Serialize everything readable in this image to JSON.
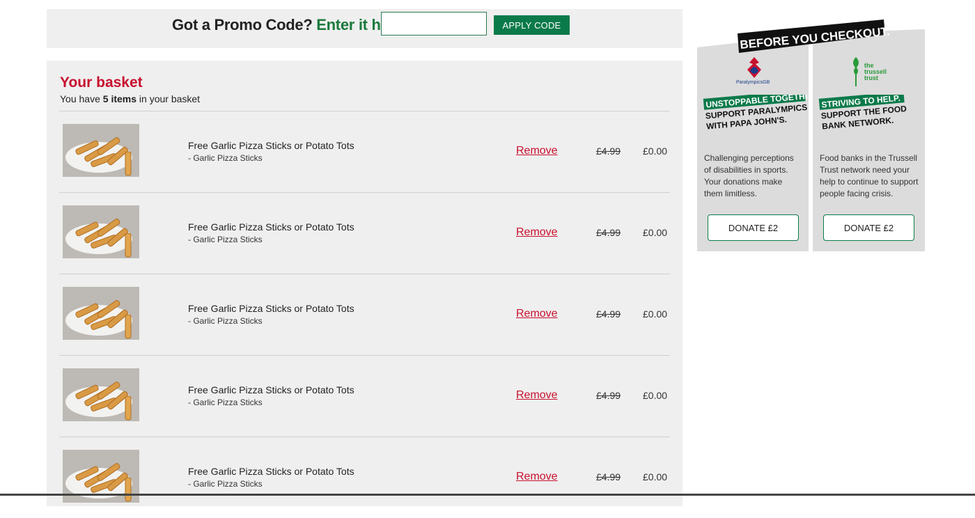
{
  "promo": {
    "question": "Got a Promo Code?",
    "link_text": "Enter it here",
    "input_value": "",
    "button_label": "APPLY CODE"
  },
  "basket": {
    "title": "Your basket",
    "subtitle_prefix": "You have",
    "count_text": "5 items",
    "subtitle_suffix": "in your basket",
    "items": [
      {
        "name": "Free Garlic Pizza Sticks or Potato Tots",
        "option": "- Garlic Pizza Sticks",
        "remove": "Remove",
        "old_price": "£4.99",
        "price": "£0.00"
      },
      {
        "name": "Free Garlic Pizza Sticks or Potato Tots",
        "option": "- Garlic Pizza Sticks",
        "remove": "Remove",
        "old_price": "£4.99",
        "price": "£0.00"
      },
      {
        "name": "Free Garlic Pizza Sticks or Potato Tots",
        "option": "- Garlic Pizza Sticks",
        "remove": "Remove",
        "old_price": "£4.99",
        "price": "£0.00"
      },
      {
        "name": "Free Garlic Pizza Sticks or Potato Tots",
        "option": "- Garlic Pizza Sticks",
        "remove": "Remove",
        "old_price": "£4.99",
        "price": "£0.00"
      },
      {
        "name": "Free Garlic Pizza Sticks or Potato Tots",
        "option": "- Garlic Pizza Sticks",
        "remove": "Remove",
        "old_price": "£4.99",
        "price": "£0.00"
      }
    ]
  },
  "checkout_promo": {
    "heading": "BEFORE YOU CHECKOUT.",
    "cards": [
      {
        "logo_text": "ParalympicsGB",
        "headline_1": "UNSTOPPABLE TOGETHER.",
        "headline_2": "SUPPORT PARALYMPICSGB",
        "headline_3": "WITH PAPA JOHN'S.",
        "body": "Challenging perceptions of disabilities in sports. Your donations make them limitless.",
        "button_label": "DONATE £2"
      },
      {
        "logo_text_1": "the",
        "logo_text_2": "trussell",
        "logo_text_3": "trust",
        "headline_1": "STRIVING TO HELP.",
        "headline_2": "SUPPORT THE FOOD",
        "headline_3": "BANK NETWORK.",
        "body": "Food banks in the Trussell Trust network need your help to continue to support people facing crisis.",
        "button_label": "DONATE £2"
      }
    ]
  },
  "colors": {
    "brand_green": "#0b7a4a",
    "accent_red": "#c8102e",
    "panel_grey": "#efefef"
  }
}
